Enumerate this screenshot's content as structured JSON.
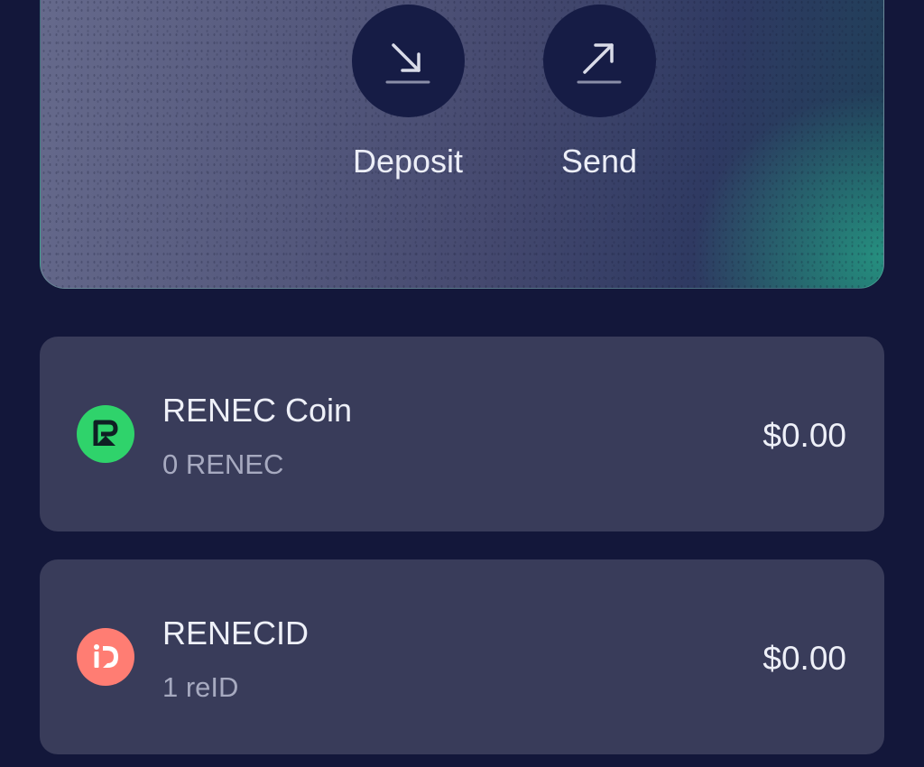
{
  "actions": {
    "deposit": {
      "label": "Deposit",
      "icon": "arrow-down-right-icon"
    },
    "send": {
      "label": "Send",
      "icon": "arrow-up-right-icon"
    }
  },
  "tokens": [
    {
      "name": "RENEC Coin",
      "amount": "0 RENEC",
      "value": "$0.00",
      "icon": "renec-logo-icon",
      "icon_color": "#2fd36b"
    },
    {
      "name": "RENECID",
      "amount": "1 reID",
      "value": "$0.00",
      "icon": "renecid-logo-icon",
      "icon_color": "#ff7d73"
    }
  ],
  "colors": {
    "background": "#13173a",
    "card": "#393c5a",
    "action_circle": "#161c45",
    "text_primary": "#eef0f8",
    "text_secondary": "#a7aac0"
  }
}
